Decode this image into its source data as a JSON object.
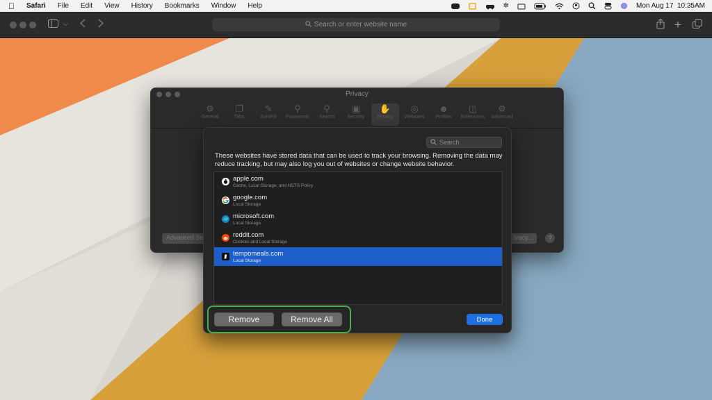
{
  "menubar": {
    "app_name": "Safari",
    "items": [
      "File",
      "Edit",
      "View",
      "History",
      "Bookmarks",
      "Window",
      "Help"
    ],
    "datetime": "Mon Aug 17  10:35AM"
  },
  "toolbar": {
    "url_placeholder": "Search or enter website name"
  },
  "prefs": {
    "title": "Privacy",
    "tabs": [
      {
        "label": "General",
        "icon": "gear-icon"
      },
      {
        "label": "Tabs",
        "icon": "tabs-icon"
      },
      {
        "label": "AutoFill",
        "icon": "autofill-icon"
      },
      {
        "label": "Passwords",
        "icon": "key-icon"
      },
      {
        "label": "Search",
        "icon": "search-icon"
      },
      {
        "label": "Security",
        "icon": "lock-icon"
      },
      {
        "label": "Privacy",
        "icon": "hand-icon"
      },
      {
        "label": "Websites",
        "icon": "globe-icon"
      },
      {
        "label": "Profiles",
        "icon": "person-icon"
      },
      {
        "label": "Extensions",
        "icon": "puzzle-icon"
      },
      {
        "label": "Advanced",
        "icon": "advanced-gears-icon"
      }
    ],
    "advanced_btn": "Advanced Se",
    "privacy_btn": "ivacy...",
    "help": "?"
  },
  "sheet": {
    "search_placeholder": "Search",
    "explanation": "These websites have stored data that can be used to track your browsing. Removing the data may reduce tracking, but may also log you out of websites or change website behavior.",
    "sites": [
      {
        "name": "apple.com",
        "detail": "Cache, Local Storage, and HSTS Policy",
        "icon": "apple-logo-icon",
        "selected": false
      },
      {
        "name": "google.com",
        "detail": "Local Storage",
        "icon": "google-logo-icon",
        "selected": false
      },
      {
        "name": "microsoft.com",
        "detail": "Local Storage",
        "icon": "edge-logo-icon",
        "selected": false
      },
      {
        "name": "reddit.com",
        "detail": "Cookies and Local Storage",
        "icon": "reddit-logo-icon",
        "selected": false
      },
      {
        "name": "tempomeals.com",
        "detail": "Local Storage",
        "icon": "tempomeals-logo-icon",
        "selected": true
      }
    ],
    "remove_label": "Remove",
    "remove_all_label": "Remove All",
    "done_label": "Done"
  },
  "colors": {
    "accent": "#1e5ec9",
    "highlight": "#4cae50"
  }
}
